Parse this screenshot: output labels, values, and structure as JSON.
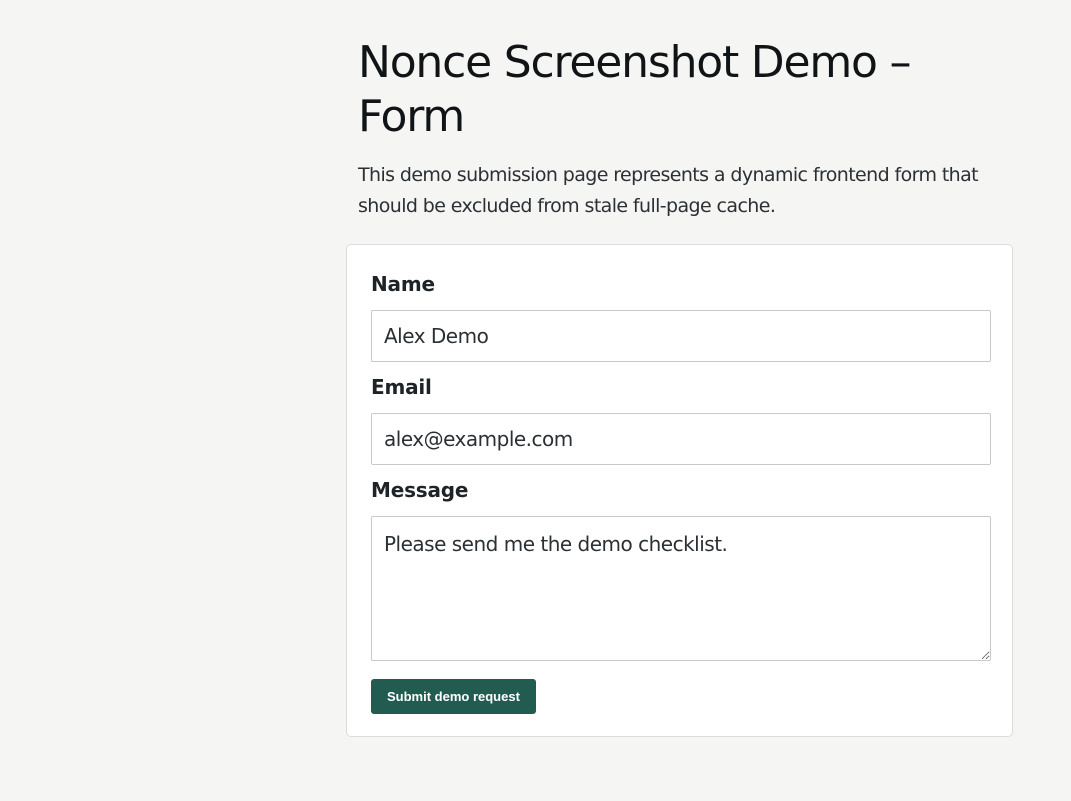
{
  "page": {
    "title": "Nonce Screenshot Demo – Form",
    "intro": "This demo submission page represents a dynamic frontend form that should be excluded from stale full-page cache."
  },
  "form": {
    "name": {
      "label": "Name",
      "value": "Alex Demo"
    },
    "email": {
      "label": "Email",
      "value": "alex@example.com"
    },
    "message": {
      "label": "Message",
      "value": "Please send me the demo checklist."
    },
    "submit_label": "Submit demo request"
  },
  "colors": {
    "background": "#f5f5f3",
    "button": "#225c51",
    "card": "#ffffff"
  }
}
